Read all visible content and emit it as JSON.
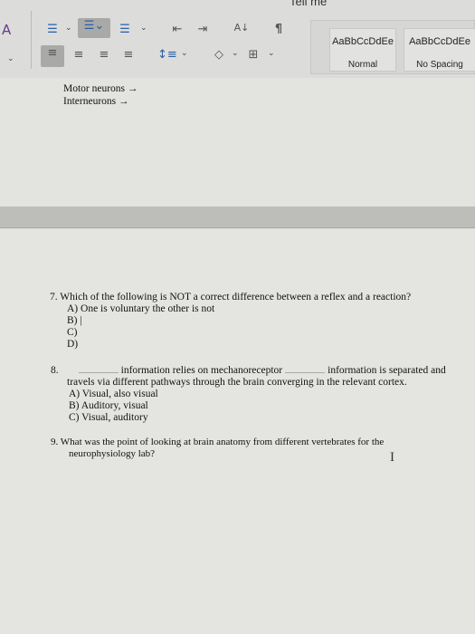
{
  "ribbon": {
    "tell_me": "Tell me",
    "styles": [
      {
        "preview": "AaBbCcDdEe",
        "name": "Normal"
      },
      {
        "preview": "AaBbCcDdEe",
        "name": "No Spacing"
      }
    ],
    "icons": [
      "styles-pane-icon",
      "bullets-icon",
      "numbering-icon",
      "multilevel-list-icon",
      "decrease-indent-icon",
      "increase-indent-icon",
      "sort-icon",
      "show-formatting-icon",
      "align-left-icon",
      "center-icon",
      "align-right-icon",
      "justify-icon",
      "line-spacing-icon",
      "shading-icon",
      "borders-icon"
    ]
  },
  "document": {
    "prev_lines": [
      "Motor neurons →",
      "Interneurons →"
    ],
    "q7": {
      "question": "7.  Which of the following is NOT a correct difference between a reflex and a reaction?",
      "options": [
        "A)  One is voluntary the other is not",
        "B)  |",
        "C)",
        "D)"
      ]
    },
    "q8": {
      "num": "8.",
      "part1": "information relies on mechanoreceptor",
      "part2": "information is separated and",
      "line2": "travels via different pathways through the brain converging in the relevant cortex.",
      "options": [
        "A)  Visual, also visual",
        "B)  Auditory, visual",
        "C)  Visual, auditory"
      ]
    },
    "q9": {
      "question": "9.  What was the point of looking at brain anatomy from different vertebrates for the",
      "line2": "neurophysiology lab?"
    },
    "cursor": "I"
  }
}
